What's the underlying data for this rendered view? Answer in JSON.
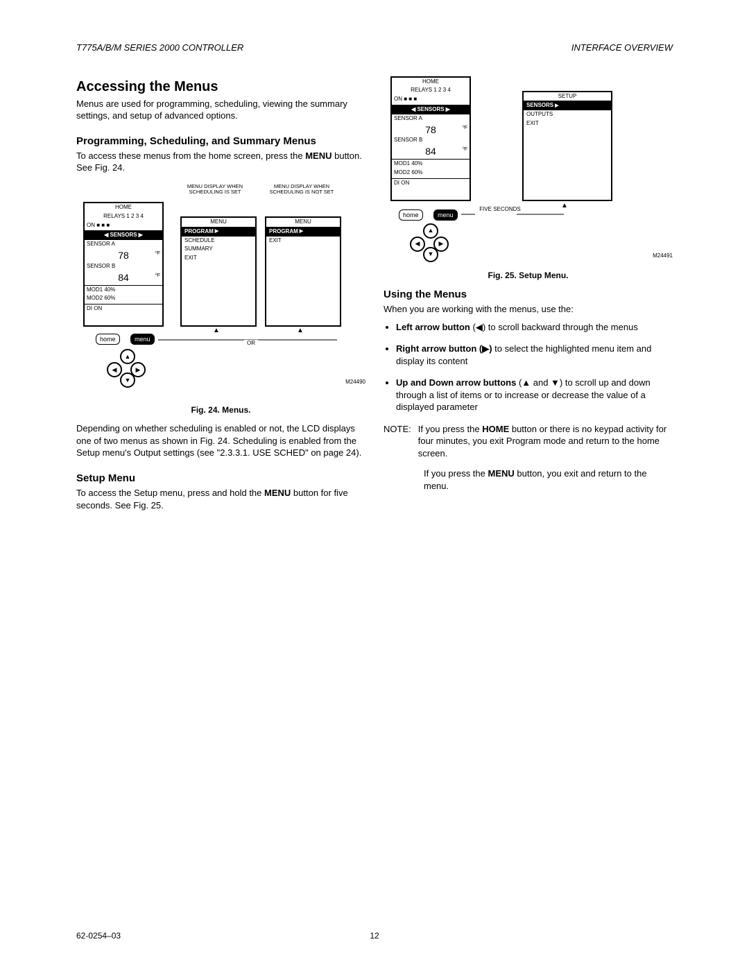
{
  "header": {
    "left": "T775A/B/M SERIES 2000 CONTROLLER",
    "right": "INTERFACE OVERVIEW"
  },
  "main_heading": "Accessing the Menus",
  "intro": "Menus are used for programming, scheduling, viewing the summary settings, and setup of advanced options.",
  "sub1": {
    "heading": "Programming, Scheduling, and Summary Menus",
    "text_pre": "To access these menus from the home screen, press the ",
    "menu_bold": "MENU",
    "text_post": " button. See Fig. 24."
  },
  "fig24": {
    "cap_label_left": "MENU DISPLAY WHEN SCHEDULING IS SET",
    "cap_label_right": "MENU DISPLAY WHEN SCHEDULING IS NOT SET",
    "caption": "Fig. 24.  Menus.",
    "code": "M24490",
    "or": "OR",
    "home_btn": "home",
    "menu_btn": "menu",
    "lcd_home": {
      "title": "HOME",
      "relays": "RELAYS  1  2  3  4",
      "on_row": "ON  ■ ■      ■",
      "sensors_bar": "◀ SENSORS ▶",
      "sensor_a": "SENSOR A",
      "temp_a": "78",
      "deg": "ºF",
      "sensor_b": "SENSOR B",
      "temp_b": "84",
      "mod1": "MOD1        40%",
      "mod2": "MOD2        60%",
      "di": "DI ON"
    },
    "menu_left": {
      "title": "MENU",
      "program": "PROGRAM",
      "items": [
        "SCHEDULE",
        "SUMMARY",
        "EXIT"
      ]
    },
    "menu_right": {
      "title": "MENU",
      "program": "PROGRAM",
      "items": [
        "EXIT"
      ]
    }
  },
  "depend_para": "Depending on whether scheduling is enabled or not, the LCD displays one of two menus as shown in Fig. 24. Scheduling is enabled from the Setup menu's Output settings (see \"2.3.3.1. USE SCHED\" on page 24).",
  "setup_heading": "Setup Menu",
  "setup_para_pre": "To access the Setup menu, press and hold the ",
  "setup_para_bold": "MENU",
  "setup_para_post": " button for five seconds. See Fig. 25.",
  "fig25": {
    "caption": "Fig. 25. Setup Menu.",
    "code": "M24491",
    "five_sec": "FIVE SECONDS",
    "home_btn": "home",
    "menu_btn": "menu",
    "menu_right": {
      "title": "SETUP",
      "sensors": "SENSORS",
      "items": [
        "OUTPUTS",
        "EXIT"
      ]
    }
  },
  "using_heading": "Using the Menus",
  "using_intro": "When you are working with the menus, use the:",
  "bullets": {
    "b1_bold": "Left arrow button",
    "b1_rest": " (◀) to scroll backward through the menus",
    "b2_bold": "Right arrow button (▶)",
    "b2_rest": " to select the highlighted menu item and display its content",
    "b3_bold": "Up and Down arrow buttons",
    "b3_rest": " (▲ and ▼) to scroll up and down through a list of items or to increase or decrease the value of a displayed parameter"
  },
  "note": {
    "label": "NOTE:",
    "line1_pre": "If you press the ",
    "line1_bold": "HOME",
    "line1_post": " button or there is no keypad activity for four minutes, you exit Program mode and return to the home screen.",
    "line2_pre": "If you press the ",
    "line2_bold": "MENU",
    "line2_post": " button, you exit and return to the menu."
  },
  "footer": {
    "doc": "62-0254–03",
    "page": "12"
  }
}
